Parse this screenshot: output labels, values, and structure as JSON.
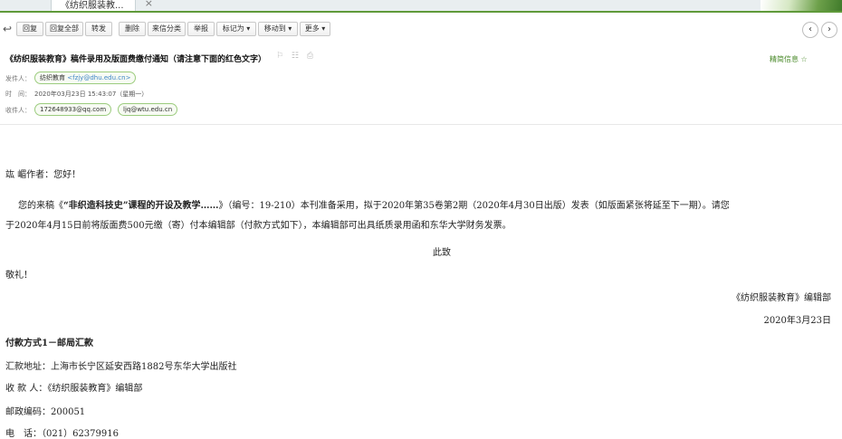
{
  "tab": {
    "title": "《纺织服装教...",
    "close": "×"
  },
  "toolbar": {
    "reply_icon": "↩",
    "buttons": [
      "回复",
      "回复全部",
      "转发",
      "删除",
      "来信分类",
      "举报",
      "标记为 ▾",
      "移动到 ▾",
      "更多 ▾"
    ],
    "prev": "‹",
    "next": "›"
  },
  "header": {
    "subject": "《纺织服装教育》稿件录用及版面费缴付通知（请注意下面的红色文字）",
    "subject_icons": "⚐ ☷ ⎙",
    "concise_link": "精简信息 ☆",
    "from_label": "发件人：",
    "from_name": "纺织教育",
    "from_email": "<fzjy@dhu.edu.cn>",
    "time_label": "时　间：",
    "time_value": "2020年03月23日 15:43:07（星期一）",
    "to_label": "收件人：",
    "to_1": "172648933@qq.com",
    "to_2": "ljq@wtu.edu.cn"
  },
  "body": {
    "greeting": "竑 嵋作者：您好！",
    "p1a_pre": "您的来稿《",
    "p1a_title": "“非织造科技史”课程的开设及教学……",
    "p1a_post": "》（编号：19-210）本刊准备采用，拟于2020年第35卷第2期（2020年4月30日出版）发表（如版面紧张将延至下一期）。请您",
    "p1b": "于2020年4月15日前将版面费500元缴（寄）付本编辑部（付款方式如下），本编辑部可出具纸质录用函和东华大学财务发票。",
    "closing1": "此致",
    "closing2": "敬礼！",
    "signature": "《纺织服装教育》编辑部",
    "date": "2020年3月23日",
    "payment_title": "付款方式1－邮局汇款",
    "addr": "汇款地址：上海市长宁区延安西路1882号东华大学出版社",
    "recipient": "收 款 人：《纺织服装教育》编辑部",
    "postcode": "邮政编码：200051",
    "phone": "电　话：（021）62379916"
  },
  "colors": {
    "accent": "#5f9a3a",
    "link": "#3d84c6",
    "pill_border": "#9ccc7e"
  }
}
